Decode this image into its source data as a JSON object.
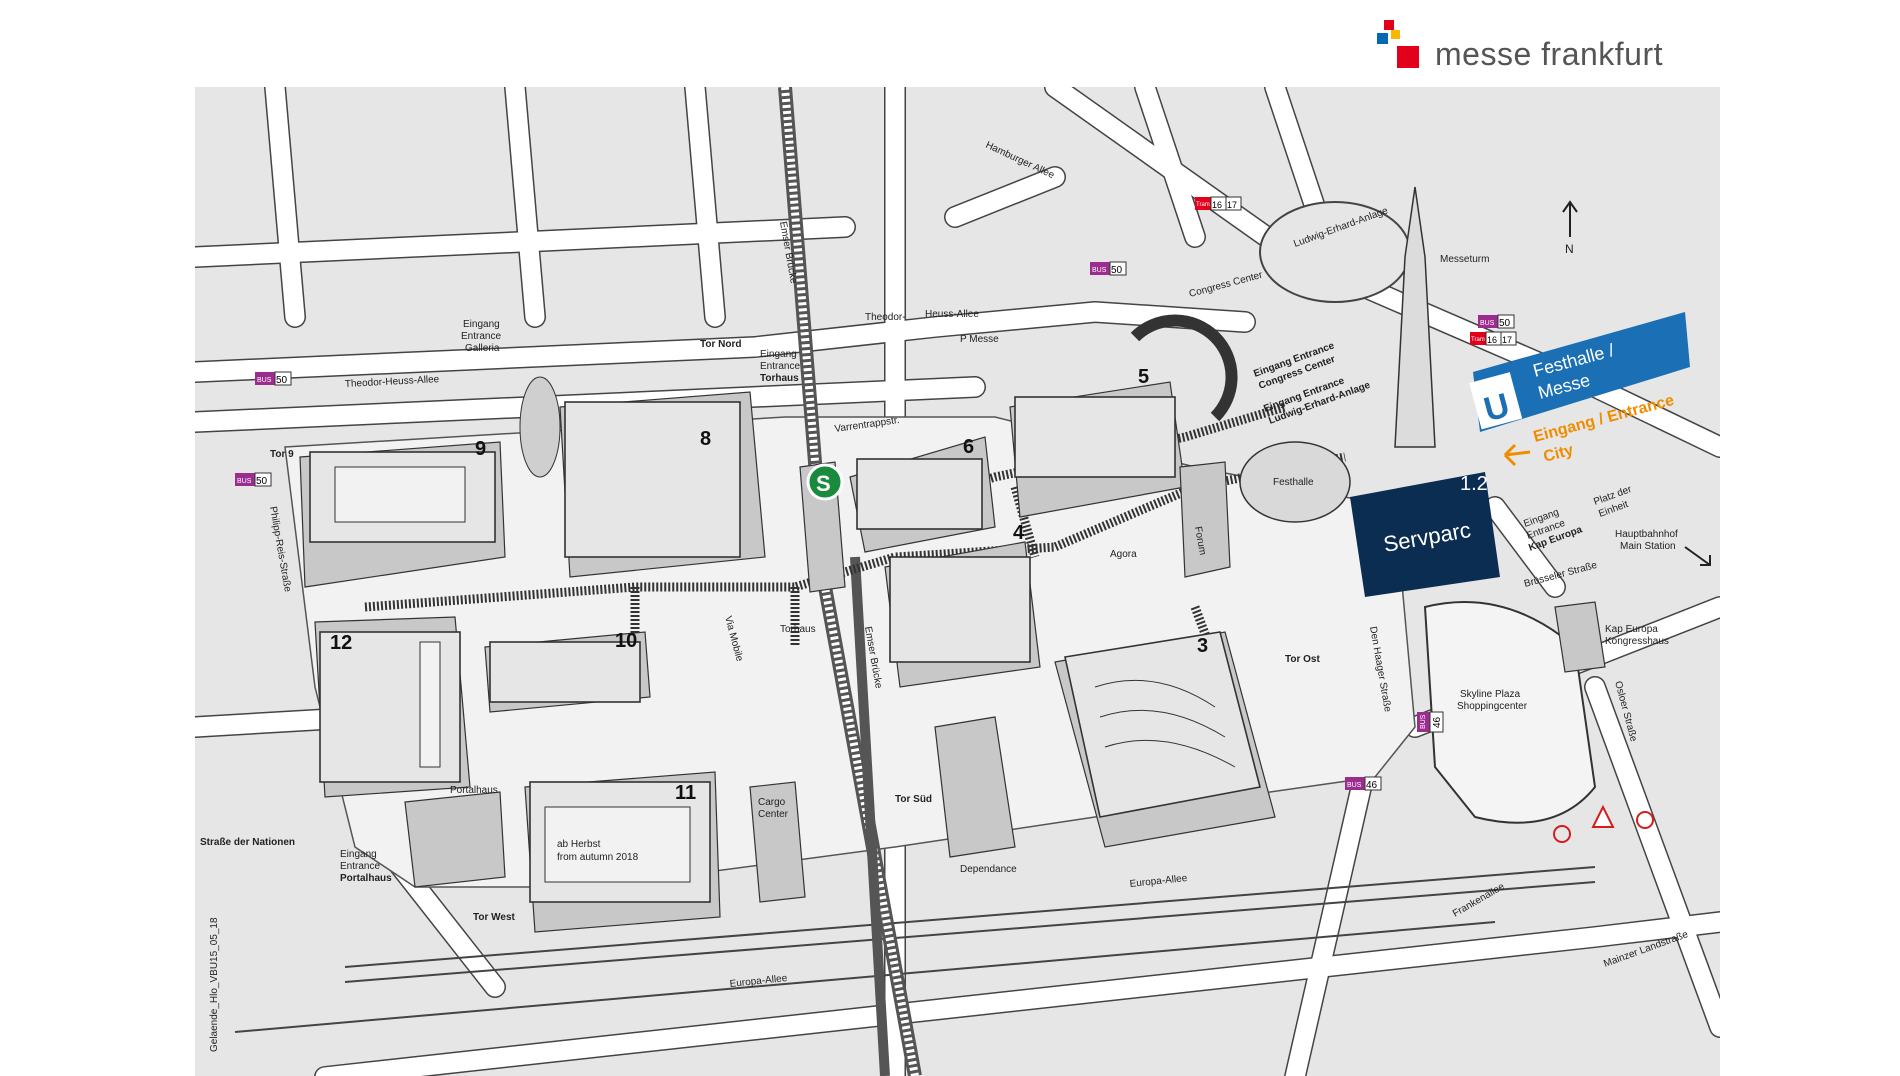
{
  "logo": {
    "text": "messe frankfurt",
    "colors": {
      "red": "#e2001a",
      "blue": "#0068b4",
      "yellow": "#f6b800"
    }
  },
  "map": {
    "background": "#e6e6e6",
    "north_label": "N",
    "halls": [
      "1.2",
      "3",
      "4",
      "5",
      "6",
      "8",
      "9",
      "10",
      "11",
      "12"
    ],
    "servparc": {
      "number": "1.2",
      "name": "Servparc",
      "color": "#0b2d52"
    },
    "ubahn": {
      "letter": "U",
      "name_line1": "Festhalle /",
      "name_line2": "Messe",
      "color": "#1a6fb5"
    },
    "sbahn": {
      "letter": "S",
      "color": "#1a8a3c"
    },
    "city_entrance": {
      "line1": "Eingang / Entrance",
      "line2": "City",
      "color": "#f08c00"
    },
    "hall12_note": {
      "line1": "ab Herbst",
      "line2": "from autumn 2018"
    },
    "labels": {
      "hamburger_allee": "Hamburger Allee",
      "ludwig_erhard": "Ludwig-Erhard-Anlage",
      "messeturm": "Messeturm",
      "congress_center": "Congress Center",
      "theodor_heuss_left": "Theodor-Heuss-Allee",
      "theodor": "Theodor-",
      "heuss_allee": "Heuss-Allee",
      "emser_bruecke_top": "Emser Brücke",
      "emser_bruecke_bottom": "Emser Brücke",
      "galleria_1": "Eingang",
      "galleria_2": "Entrance",
      "galleria_3": "Galleria",
      "torhaus_1": "Eingang",
      "torhaus_2": "Entrance",
      "torhaus_3": "Torhaus",
      "tor_nord": "Tor Nord",
      "tor_9": "Tor 9",
      "tor_ost": "Tor Ost",
      "tor_sued": "Tor Süd",
      "tor_west": "Tor West",
      "congress_1": "Eingang Entrance",
      "congress_2": "Congress Center",
      "ludwig_1": "Eingang Entrance",
      "ludwig_2": "Ludwig-Erhard-Anlage",
      "kap_1": "Eingang",
      "kap_2": "Entrance",
      "kap_3": "Kap Europa",
      "platz_1": "Platz der",
      "platz_2": "Einheit",
      "hbf_1": "Hauptbahnhof",
      "hbf_2": "Main Station",
      "varrentrappstr": "Varrentrappstr.",
      "p_messe": "P Messe",
      "agora": "Agora",
      "forum": "Forum",
      "festhalle": "Festhalle",
      "torhaus": "Torhaus",
      "via_mobile": "Via Mobile",
      "cargo_1": "Cargo",
      "cargo_2": "Center",
      "dependance": "Dependance",
      "portalhaus": "Portalhaus",
      "portal_1": "Eingang",
      "portal_2": "Entrance",
      "portal_3": "Portalhaus",
      "strasse_der_nationen": "Straße der Nationen",
      "philipp_reis": "Philipp-Reis-Straße",
      "europa_allee_left": "Europa-Allee",
      "europa_allee_right": "Europa-Allee",
      "den_haager": "Den Haager Straße",
      "bruesseler": "Brüsseler Straße",
      "skyline_1": "Skyline Plaza",
      "skyline_2": "Shoppingcenter",
      "kapkongress_1": "Kap Europa",
      "kapkongress_2": "Kongresshaus",
      "osloer": "Osloer Straße",
      "frankenallee": "Frankenallee",
      "mainzer": "Mainzer Landstraße",
      "code": "Gelaende_Hlo_VBU15_05_18"
    },
    "bus": [
      {
        "label": "BUS",
        "number": "50"
      },
      {
        "label": "BUS",
        "number": "50"
      },
      {
        "label": "BUS",
        "number": "50"
      },
      {
        "label": "BUS",
        "number": "50"
      },
      {
        "label": "BUS",
        "number": "46"
      },
      {
        "label": "BUS",
        "number": "46"
      }
    ],
    "tram": [
      {
        "label": "Tram",
        "n1": "16",
        "n2": "17"
      },
      {
        "label": "Tram",
        "n1": "16",
        "n2": "17"
      }
    ]
  }
}
